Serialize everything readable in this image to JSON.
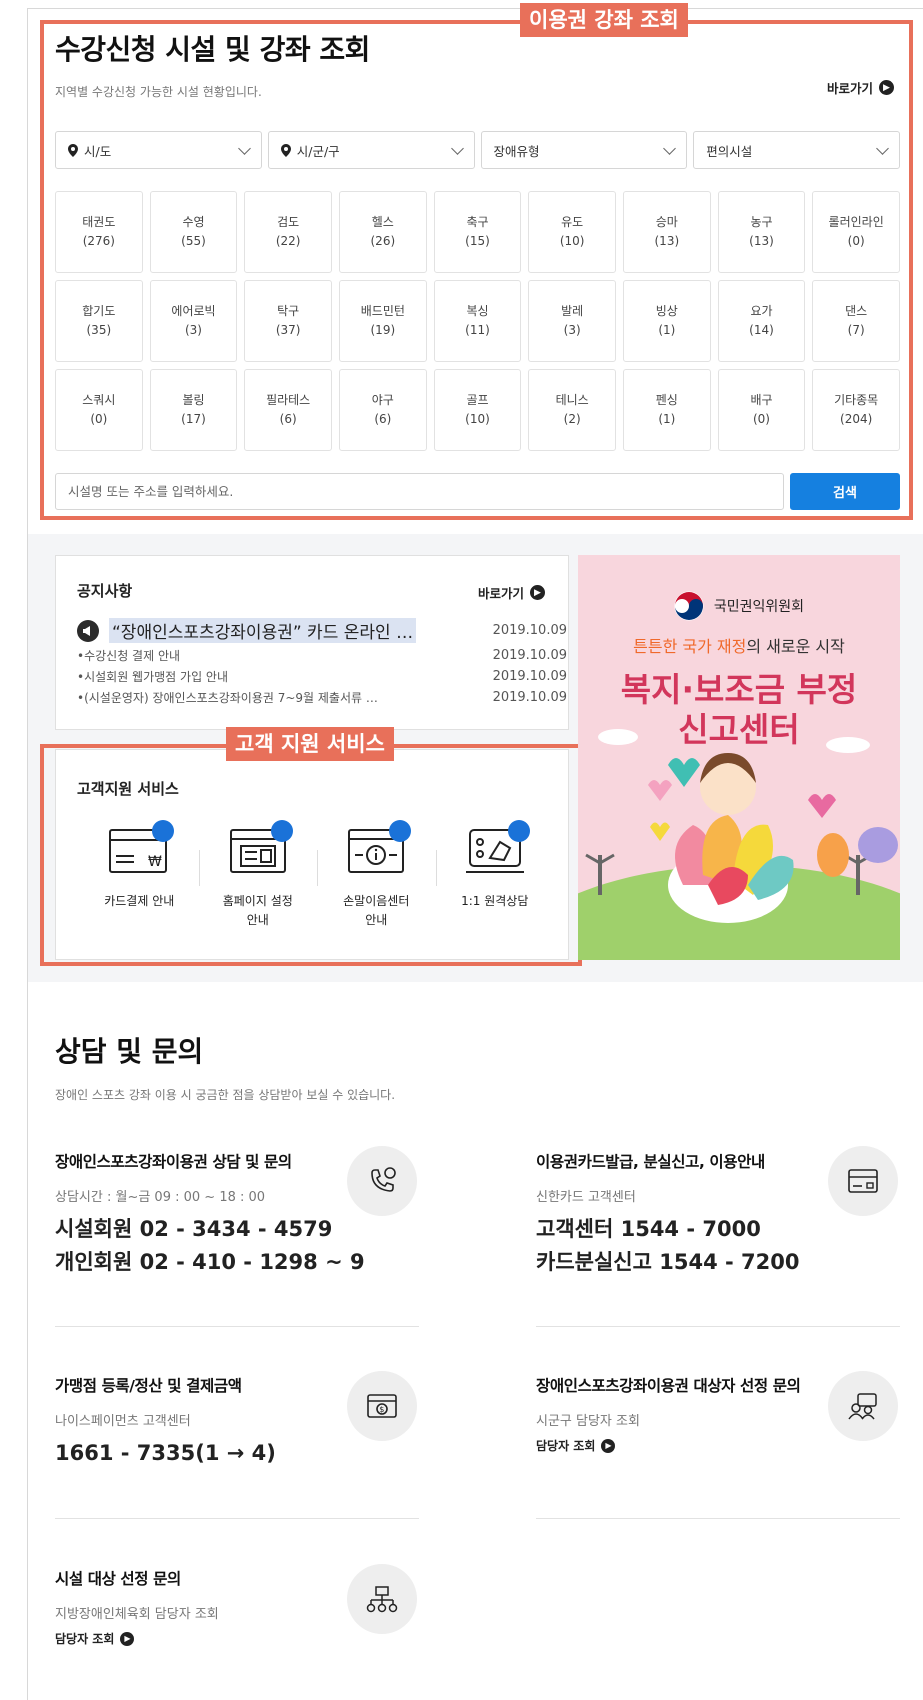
{
  "lesson_search": {
    "tag": "이용권 강좌 조회",
    "title": "수강신청 시설 및 강좌 조회",
    "subtitle": "지역별 수강신청 가능한 시설 현황입니다.",
    "goto_label": "바로가기",
    "filters": [
      "시/도",
      "시/군/구",
      "장애유형",
      "편의시설"
    ],
    "sports": [
      {
        "name": "태권도",
        "count": "(276)"
      },
      {
        "name": "수영",
        "count": "(55)"
      },
      {
        "name": "검도",
        "count": "(22)"
      },
      {
        "name": "헬스",
        "count": "(26)"
      },
      {
        "name": "축구",
        "count": "(15)"
      },
      {
        "name": "유도",
        "count": "(10)"
      },
      {
        "name": "승마",
        "count": "(13)"
      },
      {
        "name": "농구",
        "count": "(13)"
      },
      {
        "name": "롤러인라인",
        "count": "(0)"
      },
      {
        "name": "합기도",
        "count": "(35)"
      },
      {
        "name": "에어로빅",
        "count": "(3)"
      },
      {
        "name": "탁구",
        "count": "(37)"
      },
      {
        "name": "배드민턴",
        "count": "(19)"
      },
      {
        "name": "복싱",
        "count": "(11)"
      },
      {
        "name": "발레",
        "count": "(3)"
      },
      {
        "name": "빙상",
        "count": "(1)"
      },
      {
        "name": "요가",
        "count": "(14)"
      },
      {
        "name": "댄스",
        "count": "(7)"
      },
      {
        "name": "스쿼시",
        "count": "(0)"
      },
      {
        "name": "볼링",
        "count": "(17)"
      },
      {
        "name": "필라테스",
        "count": "(6)"
      },
      {
        "name": "야구",
        "count": "(6)"
      },
      {
        "name": "골프",
        "count": "(10)"
      },
      {
        "name": "테니스",
        "count": "(2)"
      },
      {
        "name": "펜싱",
        "count": "(1)"
      },
      {
        "name": "배구",
        "count": "(0)"
      },
      {
        "name": "기타종목",
        "count": "(204)"
      }
    ],
    "search_placeholder": "시설명 또는 주소를 입력하세요.",
    "search_button": "검색"
  },
  "notice": {
    "title": "공지사항",
    "goto_label": "바로가기",
    "items": [
      {
        "text": "“장애인스포츠강좌이용권” 카드 온라인 …",
        "date": "2019.10.09"
      },
      {
        "text": "•수강신청 결제 안내",
        "date": "2019.10.09"
      },
      {
        "text": "•시설회원 웹가맹점 가입 안내",
        "date": "2019.10.09"
      },
      {
        "text": "•(시설운영자) 장애인스포츠강좌이용권 7~9월 제출서류 …",
        "date": "2019.10.09"
      }
    ]
  },
  "support": {
    "tag": "고객 지원 서비스",
    "title": "고객지원 서비스",
    "items": [
      {
        "label": "카드결제 안내",
        "icon": "card-payment-icon"
      },
      {
        "label": "홈페이지 설정\n안내",
        "icon": "homepage-settings-icon"
      },
      {
        "label": "손말이음센터\n안내",
        "icon": "sign-language-center-icon"
      },
      {
        "label": "1:1 원격상담",
        "icon": "remote-consult-icon"
      }
    ]
  },
  "banner": {
    "org": "국민권익위원회",
    "tagline_accent": "튼튼한 국가 재정",
    "tagline_rest": "의 새로운 시작",
    "headline_1": "복지·보조금 부정",
    "headline_2": "신고센터"
  },
  "consult": {
    "title": "상담 및 문의",
    "subtitle": "장애인 스포츠 강좌 이용 시 궁금한 점을 상담받아 보실 수 있습니다.",
    "items": [
      {
        "title": "장애인스포츠강좌이용권 상담 및 문의",
        "desc": "상담시간 : 월~금 09 : 00 ~ 18 : 00",
        "line1": "시설회원 02 - 3434 - 4579",
        "line2": "개인회원 02 - 410 - 1298 ~ 9",
        "icon": "phone-chat-icon"
      },
      {
        "title": "이용권카드발급, 분실신고, 이용안내",
        "desc": "신한카드 고객센터",
        "line1": "고객센터 1544 - 7000",
        "line2": "카드분실신고 1544 - 7200",
        "icon": "card-icon"
      },
      {
        "title": "가맹점 등록/정산 및 결제금액",
        "desc": "나이스페이먼츠 고객센터",
        "line1": "1661 - 7335(1 → 4)",
        "icon": "payment-window-icon"
      },
      {
        "title": "장애인스포츠강좌이용권 대상자 선정 문의",
        "desc": "시군구 담당자 조회",
        "link": "담당자 조회",
        "icon": "people-chat-icon"
      },
      {
        "title": "시설 대상 선정 문의",
        "desc": "지방장애인체육회 담당자 조회",
        "link": "담당자 조회",
        "icon": "org-chart-icon"
      }
    ]
  },
  "colors": {
    "highlight": "#e8705a",
    "primary_button": "#1580e0",
    "badge_blue": "#1a72d8",
    "banner_bg": "#f8d6dd",
    "banner_headline": "#d2365b",
    "banner_accent": "#f0692b"
  }
}
